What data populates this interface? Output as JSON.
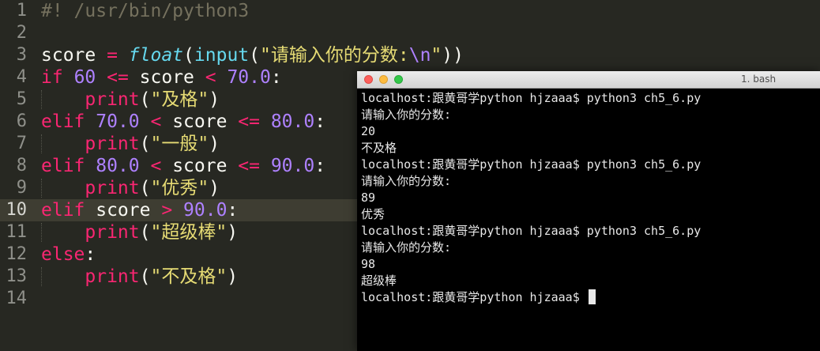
{
  "editor": {
    "current_line": 10,
    "lines": [
      {
        "num": "1",
        "tokens": [
          {
            "t": "#! /usr/bin/python3",
            "c": "cm"
          }
        ]
      },
      {
        "num": "2",
        "tokens": []
      },
      {
        "num": "3",
        "tokens": [
          {
            "t": "score",
            "c": "var"
          },
          {
            "t": " = ",
            "c": "kw"
          },
          {
            "t": "float",
            "c": "it"
          },
          {
            "t": "(",
            "c": "var"
          },
          {
            "t": "input",
            "c": "fn"
          },
          {
            "t": "(",
            "c": "var"
          },
          {
            "t": "\"请输入你的分数:",
            "c": "str"
          },
          {
            "t": "\\n",
            "c": "esc"
          },
          {
            "t": "\"",
            "c": "str"
          },
          {
            "t": "))",
            "c": "var"
          }
        ]
      },
      {
        "num": "4",
        "tokens": [
          {
            "t": "if",
            "c": "kw"
          },
          {
            "t": " ",
            "c": "var"
          },
          {
            "t": "60",
            "c": "num"
          },
          {
            "t": " <= ",
            "c": "kw"
          },
          {
            "t": "score",
            "c": "var"
          },
          {
            "t": " < ",
            "c": "kw"
          },
          {
            "t": "70.0",
            "c": "num"
          },
          {
            "t": ":",
            "c": "var"
          }
        ]
      },
      {
        "num": "5",
        "guide": true,
        "tokens": [
          {
            "t": "    ",
            "c": "var"
          },
          {
            "t": "print",
            "c": "kw"
          },
          {
            "t": "(",
            "c": "var"
          },
          {
            "t": "\"及格\"",
            "c": "str"
          },
          {
            "t": ")",
            "c": "var"
          }
        ]
      },
      {
        "num": "6",
        "tokens": [
          {
            "t": "elif",
            "c": "kw"
          },
          {
            "t": " ",
            "c": "var"
          },
          {
            "t": "70.0",
            "c": "num"
          },
          {
            "t": " < ",
            "c": "kw"
          },
          {
            "t": "score",
            "c": "var"
          },
          {
            "t": " <= ",
            "c": "kw"
          },
          {
            "t": "80.0",
            "c": "num"
          },
          {
            "t": ":",
            "c": "var"
          }
        ]
      },
      {
        "num": "7",
        "guide": true,
        "tokens": [
          {
            "t": "    ",
            "c": "var"
          },
          {
            "t": "print",
            "c": "kw"
          },
          {
            "t": "(",
            "c": "var"
          },
          {
            "t": "\"一般\"",
            "c": "str"
          },
          {
            "t": ")",
            "c": "var"
          }
        ]
      },
      {
        "num": "8",
        "tokens": [
          {
            "t": "elif",
            "c": "kw"
          },
          {
            "t": " ",
            "c": "var"
          },
          {
            "t": "80.0",
            "c": "num"
          },
          {
            "t": " < ",
            "c": "kw"
          },
          {
            "t": "score",
            "c": "var"
          },
          {
            "t": " <= ",
            "c": "kw"
          },
          {
            "t": "90.0",
            "c": "num"
          },
          {
            "t": ":",
            "c": "var"
          }
        ]
      },
      {
        "num": "9",
        "guide": true,
        "tokens": [
          {
            "t": "    ",
            "c": "var"
          },
          {
            "t": "print",
            "c": "kw"
          },
          {
            "t": "(",
            "c": "var"
          },
          {
            "t": "\"优秀\"",
            "c": "str"
          },
          {
            "t": ")",
            "c": "var"
          }
        ]
      },
      {
        "num": "10",
        "tokens": [
          {
            "t": "elif",
            "c": "kw"
          },
          {
            "t": " score",
            "c": "var"
          },
          {
            "t": " > ",
            "c": "kw"
          },
          {
            "t": "90.0",
            "c": "num"
          },
          {
            "t": ":",
            "c": "var"
          }
        ]
      },
      {
        "num": "11",
        "guide": true,
        "tokens": [
          {
            "t": "    ",
            "c": "var"
          },
          {
            "t": "print",
            "c": "kw"
          },
          {
            "t": "(",
            "c": "var"
          },
          {
            "t": "\"超级棒\"",
            "c": "str"
          },
          {
            "t": ")",
            "c": "var"
          }
        ]
      },
      {
        "num": "12",
        "tokens": [
          {
            "t": "else",
            "c": "kw"
          },
          {
            "t": ":",
            "c": "var"
          }
        ]
      },
      {
        "num": "13",
        "guide": true,
        "tokens": [
          {
            "t": "    ",
            "c": "var"
          },
          {
            "t": "print",
            "c": "kw"
          },
          {
            "t": "(",
            "c": "var"
          },
          {
            "t": "\"不及格\"",
            "c": "str"
          },
          {
            "t": ")",
            "c": "var"
          }
        ]
      },
      {
        "num": "14",
        "tokens": []
      }
    ]
  },
  "terminal": {
    "title": "1. bash",
    "lines": [
      "localhost:跟黄哥学python hjzaaa$ python3 ch5_6.py",
      "请输入你的分数:",
      "20",
      "不及格",
      "localhost:跟黄哥学python hjzaaa$ python3 ch5_6.py",
      "请输入你的分数:",
      "89",
      "优秀",
      "localhost:跟黄哥学python hjzaaa$ python3 ch5_6.py",
      "请输入你的分数:",
      "98",
      "超级棒",
      "localhost:跟黄哥学python hjzaaa$ "
    ]
  },
  "colors": {
    "editor_bg": "#272822",
    "keyword": "#f92672",
    "number": "#ae81ff",
    "string": "#e6db74",
    "function": "#66d9ef",
    "comment": "#75715e",
    "terminal_bg": "#000000"
  }
}
